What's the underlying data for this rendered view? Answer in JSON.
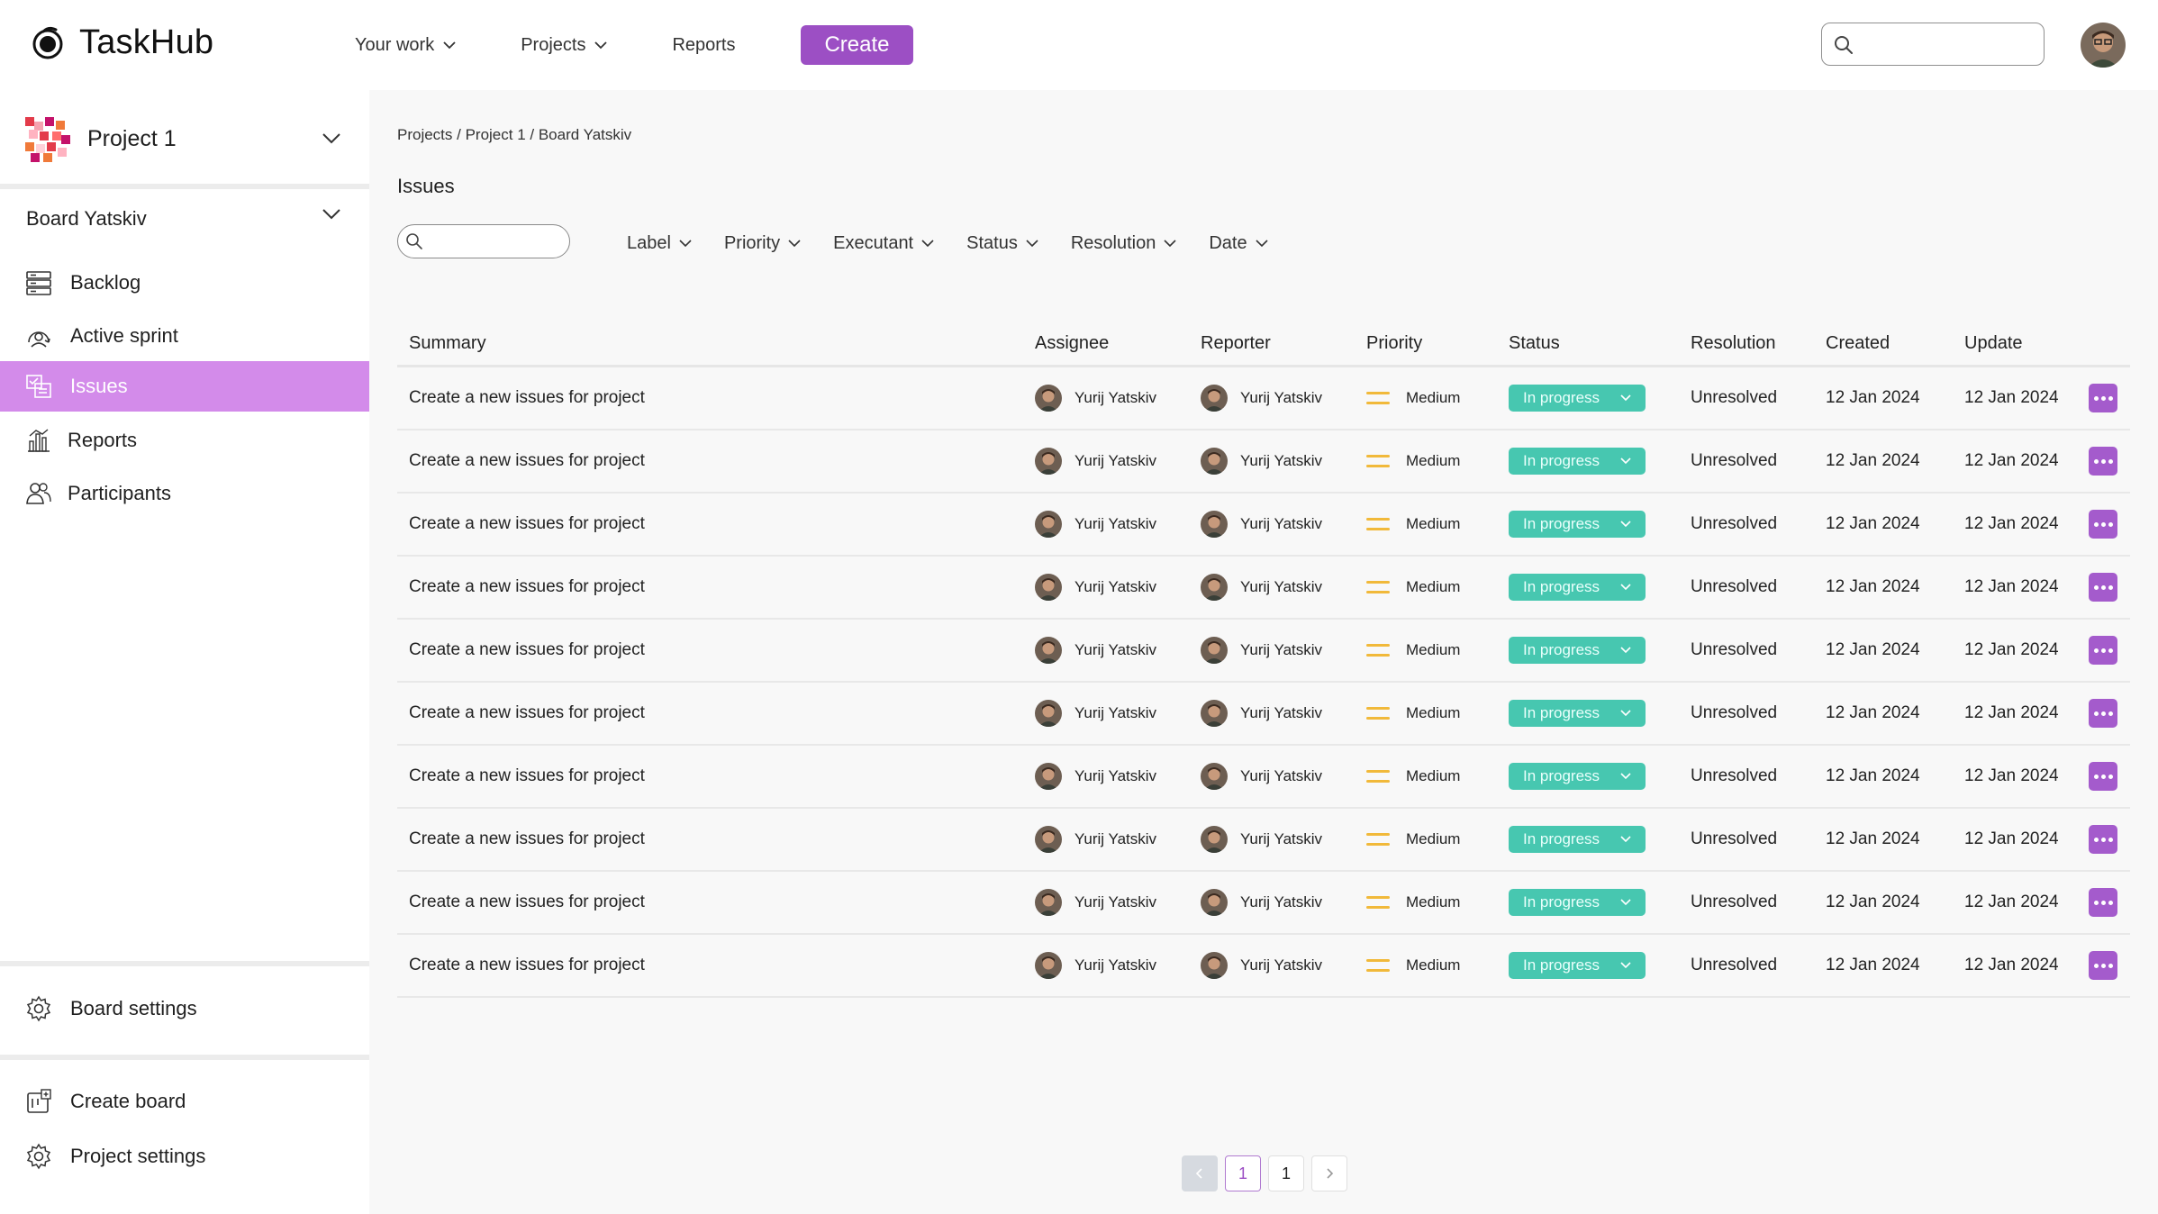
{
  "app": {
    "name": "TaskHub",
    "nav": [
      {
        "label": "Your work",
        "has_dropdown": true
      },
      {
        "label": "Projects",
        "has_dropdown": true
      },
      {
        "label": "Reports",
        "has_dropdown": false
      }
    ],
    "create_label": "Create",
    "accent_color": "#9c4fc4"
  },
  "sidebar": {
    "project_name": "Project 1",
    "board_name": "Board Yatskiv",
    "items": [
      {
        "label": "Backlog",
        "icon": "backlog-icon",
        "active": false
      },
      {
        "label": "Active sprint",
        "icon": "sprint-icon",
        "active": false
      },
      {
        "label": "Issues",
        "icon": "issues-icon",
        "active": true
      },
      {
        "label": "Reports",
        "icon": "reports-icon",
        "active": false
      },
      {
        "label": "Participants",
        "icon": "participants-icon",
        "active": false
      }
    ],
    "board_settings": "Board settings",
    "create_board": "Create board",
    "project_settings": "Project settings"
  },
  "main": {
    "breadcrumb": "Projects / Project 1 / Board Yatskiv",
    "title": "Issues",
    "filters": [
      "Label",
      "Priority",
      "Executant",
      "Status",
      "Resolution",
      "Date"
    ],
    "columns": [
      "Summary",
      "Assignee",
      "Reporter",
      "Priority",
      "Status",
      "Resolution",
      "Created",
      "Update"
    ],
    "rows": [
      {
        "summary": "Create a new issues for project",
        "assignee": "Yurij Yatskiv",
        "reporter": "Yurij Yatskiv",
        "priority": "Medium",
        "status": "In progress",
        "resolution": "Unresolved",
        "created": "12 Jan 2024",
        "updated": "12 Jan 2024"
      },
      {
        "summary": "Create a new issues for project",
        "assignee": "Yurij Yatskiv",
        "reporter": "Yurij Yatskiv",
        "priority": "Medium",
        "status": "In progress",
        "resolution": "Unresolved",
        "created": "12 Jan 2024",
        "updated": "12 Jan 2024"
      },
      {
        "summary": "Create a new issues for project",
        "assignee": "Yurij Yatskiv",
        "reporter": "Yurij Yatskiv",
        "priority": "Medium",
        "status": "In progress",
        "resolution": "Unresolved",
        "created": "12 Jan 2024",
        "updated": "12 Jan 2024"
      },
      {
        "summary": "Create a new issues for project",
        "assignee": "Yurij Yatskiv",
        "reporter": "Yurij Yatskiv",
        "priority": "Medium",
        "status": "In progress",
        "resolution": "Unresolved",
        "created": "12 Jan 2024",
        "updated": "12 Jan 2024"
      },
      {
        "summary": "Create a new issues for project",
        "assignee": "Yurij Yatskiv",
        "reporter": "Yurij Yatskiv",
        "priority": "Medium",
        "status": "In progress",
        "resolution": "Unresolved",
        "created": "12 Jan 2024",
        "updated": "12 Jan 2024"
      },
      {
        "summary": "Create a new issues for project",
        "assignee": "Yurij Yatskiv",
        "reporter": "Yurij Yatskiv",
        "priority": "Medium",
        "status": "In progress",
        "resolution": "Unresolved",
        "created": "12 Jan 2024",
        "updated": "12 Jan 2024"
      },
      {
        "summary": "Create a new issues for project",
        "assignee": "Yurij Yatskiv",
        "reporter": "Yurij Yatskiv",
        "priority": "Medium",
        "status": "In progress",
        "resolution": "Unresolved",
        "created": "12 Jan 2024",
        "updated": "12 Jan 2024"
      },
      {
        "summary": "Create a new issues for project",
        "assignee": "Yurij Yatskiv",
        "reporter": "Yurij Yatskiv",
        "priority": "Medium",
        "status": "In progress",
        "resolution": "Unresolved",
        "created": "12 Jan 2024",
        "updated": "12 Jan 2024"
      },
      {
        "summary": "Create a new issues for project",
        "assignee": "Yurij Yatskiv",
        "reporter": "Yurij Yatskiv",
        "priority": "Medium",
        "status": "In progress",
        "resolution": "Unresolved",
        "created": "12 Jan 2024",
        "updated": "12 Jan 2024"
      },
      {
        "summary": "Create a new issues for project",
        "assignee": "Yurij Yatskiv",
        "reporter": "Yurij Yatskiv",
        "priority": "Medium",
        "status": "In progress",
        "resolution": "Unresolved",
        "created": "12 Jan 2024",
        "updated": "12 Jan 2024"
      }
    ],
    "status_color": "#47c7b0",
    "priority_color": "#f1b93a"
  },
  "pagination": {
    "current_page": "1",
    "total_pages": "1"
  }
}
